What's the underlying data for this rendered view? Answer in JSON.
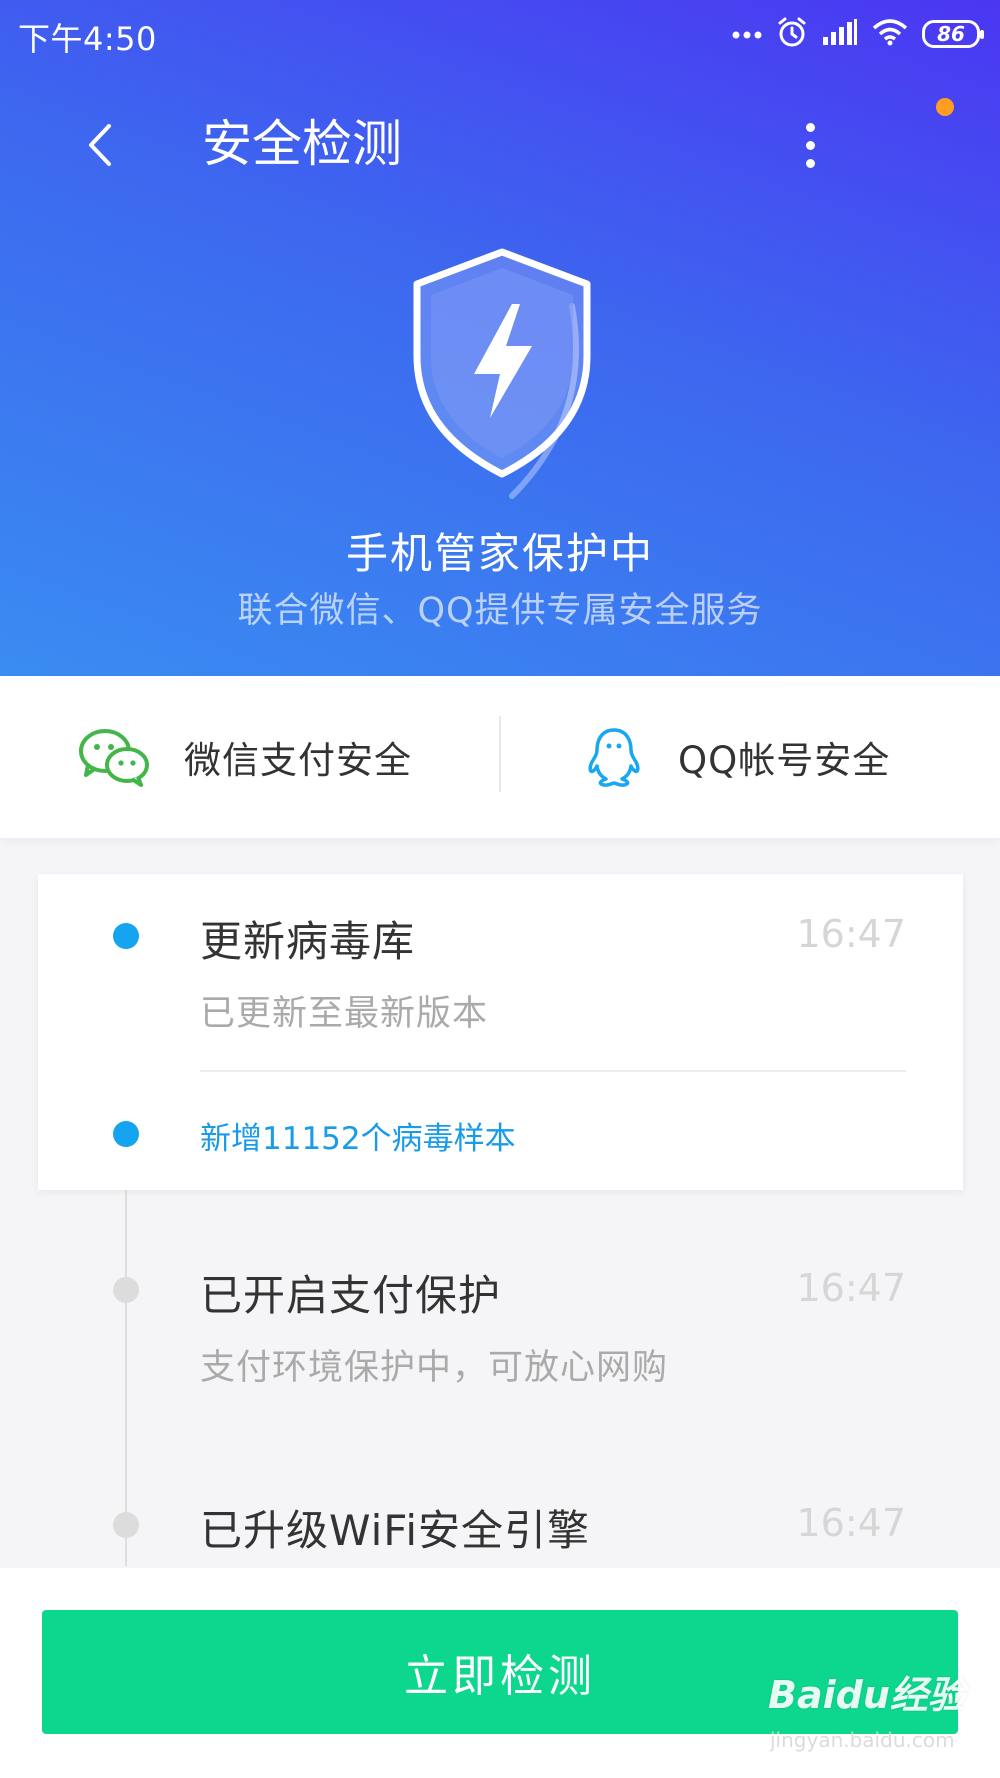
{
  "status_bar": {
    "time": "下午4:50",
    "battery": "86",
    "icons": [
      "more-dots-icon",
      "alarm-icon",
      "signal-icon",
      "wifi-icon",
      "battery-icon"
    ]
  },
  "header": {
    "title": "安全检测",
    "back_icon": "chevron-left-icon",
    "menu_icon": "more-vertical-icon",
    "notification_dot_color": "#ff9c22"
  },
  "hero": {
    "icon": "shield-lightning-icon",
    "title": "手机管家保护中",
    "subtitle": "联合微信、QQ提供专属安全服务"
  },
  "quick_actions": [
    {
      "icon": "wechat-icon",
      "label": "微信支付安全",
      "color": "#44b549"
    },
    {
      "icon": "qq-penguin-icon",
      "label": "QQ帐号安全",
      "color": "#18a7f0"
    }
  ],
  "timeline": [
    {
      "title": "更新病毒库",
      "time": "16:47",
      "desc": "已更新至最新版本",
      "sub": "新增11152个病毒样本",
      "active": true
    },
    {
      "title": "已开启支付保护",
      "time": "16:47",
      "desc": "支付环境保护中，可放心网购",
      "active": false
    },
    {
      "title": "已升级WiFi安全引擎",
      "time": "16:47",
      "active": false
    }
  ],
  "primary_button": {
    "label": "立即检测",
    "color": "#0dd68d"
  },
  "watermark": {
    "main": "Baidu经验",
    "sub": "jingyan.baidu.com"
  },
  "colors": {
    "accent_blue": "#14a4f0",
    "hero_top": "#4b36f2",
    "hero_bottom": "#3a8cf2"
  }
}
